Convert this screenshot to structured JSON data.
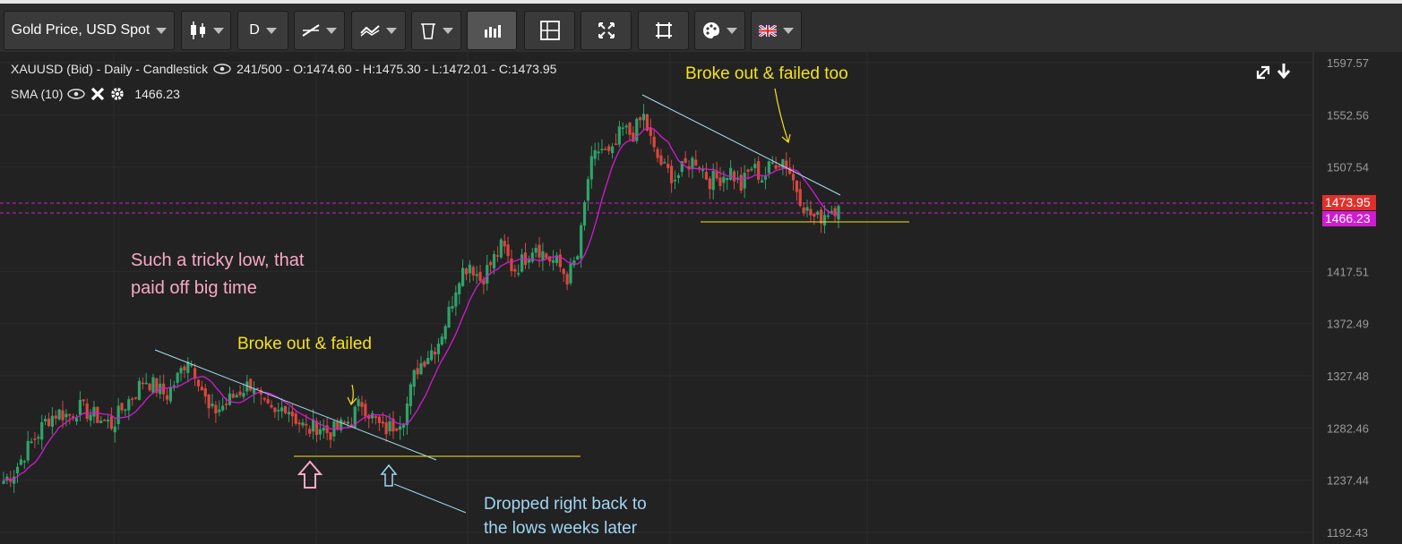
{
  "toolbar": {
    "symbol_label": "Gold Price, USD Spot",
    "interval_label": "D",
    "icons": [
      "candlestick-icon",
      "line-tool-icon",
      "indicator-icon",
      "trash-icon",
      "bar-chart-icon",
      "layout-icon",
      "fullscreen-icon",
      "crop-icon",
      "palette-icon",
      "uk-flag-icon"
    ]
  },
  "legend": {
    "main": "XAUUSD (Bid) - Daily - Candlestick",
    "stats": "241/500 - O:1474.60 - H:1475.30 - L:1472.01 - C:1473.95",
    "sma_label": "SMA (10)",
    "sma_value": "1466.23"
  },
  "price_axis": {
    "ticks": [
      "1597.57",
      "1552.56",
      "1507.54",
      "1417.51",
      "1372.49",
      "1327.48",
      "1282.46",
      "1237.44",
      "1192.43"
    ],
    "last_price": "1473.95",
    "sma_price": "1466.23",
    "last_price_color": "#e0302b",
    "sma_price_color": "#d11bd1"
  },
  "annotations": {
    "tricky_low_line1": "Such a tricky low, that",
    "tricky_low_line2": "paid off big time",
    "broke_out_failed": "Broke out & failed",
    "broke_out_failed_too": "Broke out & failed too",
    "dropped_line1": "Dropped right back to",
    "dropped_line2": "the lows weeks later"
  },
  "colors": {
    "bull": "#2fa36b",
    "bear": "#d9473f",
    "sma": "#d11bd1",
    "yellow_note": "#f4e21c",
    "pink_note": "#f7a9c6",
    "blue_note": "#9fd6f2"
  },
  "chart_data": {
    "type": "candlestick",
    "symbol": "XAUUSD",
    "ylim": [
      1192.43,
      1597.57
    ],
    "close_path": [
      1237,
      1245,
      1262,
      1275,
      1290,
      1296,
      1293,
      1300,
      1295,
      1290,
      1285,
      1300,
      1312,
      1325,
      1318,
      1310,
      1325,
      1344,
      1325,
      1295,
      1300,
      1308,
      1316,
      1322,
      1300,
      1292,
      1303,
      1290,
      1280,
      1285,
      1278,
      1283,
      1290,
      1305,
      1292,
      1280,
      1285,
      1295,
      1332,
      1345,
      1355,
      1380,
      1415,
      1425,
      1410,
      1425,
      1440,
      1418,
      1428,
      1442,
      1430,
      1425,
      1412,
      1432,
      1505,
      1525,
      1515,
      1540,
      1535,
      1552,
      1520,
      1505,
      1498,
      1510,
      1515,
      1496,
      1498,
      1505,
      1490,
      1508,
      1498,
      1512,
      1515,
      1492,
      1470,
      1462,
      1470,
      1474
    ]
  }
}
